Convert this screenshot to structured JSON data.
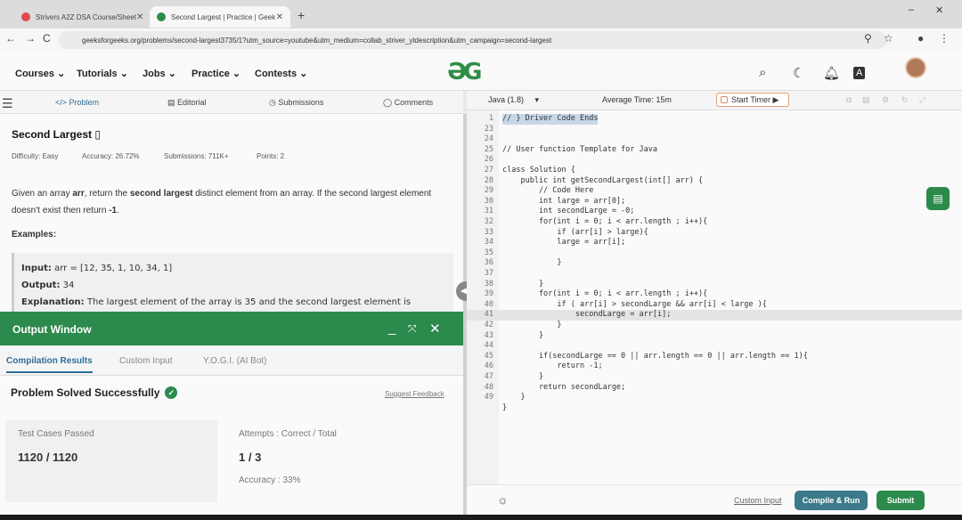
{
  "browser": {
    "tabs": [
      {
        "label": "Strivers A2Z DSA Course/Sheet",
        "active": false,
        "favicon_color": "#e24b4b"
      },
      {
        "label": "Second Largest | Practice | Geek",
        "active": true,
        "favicon_color": "#2f8d46"
      }
    ],
    "new_tab": "+",
    "url": "geeksforgeeks.org/problems/second-largest3735/1?utm_source=youtube&utm_medium=collab_striver_ytdescription&utm_campaign=second-largest",
    "nav": {
      "back": "←",
      "forward": "→",
      "reload": "C"
    },
    "win": {
      "min": "–",
      "max": "◻",
      "close": "✕"
    }
  },
  "site": {
    "menu": [
      "Courses ⌄",
      "Tutorials ⌄",
      "Jobs ⌄",
      "Practice ⌄",
      "Contests ⌄"
    ],
    "logo": "ƏG",
    "brand_color": "#2f8d46"
  },
  "problem_tabs": [
    "Problem",
    "Editorial",
    "Submissions",
    "Comments"
  ],
  "problem": {
    "title": "Second Largest",
    "difficulty": "Difficulty: Easy",
    "accuracy": "Accuracy: 26.72%",
    "submissions": "Submissions: 711K+",
    "points": "Points: 2",
    "description_1": "Given an array ",
    "description_arr": "arr",
    "description_2": ", return the ",
    "description_bold": "second largest",
    "description_3": " distinct element from an array. If the second largest element doesn't exist then return ",
    "description_neg": "-1",
    "description_4": ".",
    "examples_heading": "Examples:",
    "input_label": "Input:",
    "input_value": " arr = [12, 35, 1, 10, 34, 1]",
    "output_label": "Output:",
    "output_value": " 34",
    "explanation_label": "Explanation:",
    "explanation_value": " The largest element of the array is 35 and the second largest element is"
  },
  "output_window": {
    "title": "Output Window",
    "tabs": [
      "Compilation Results",
      "Custom Input",
      "Y.O.G.I. (AI Bot)"
    ],
    "status": "Problem Solved Successfully",
    "feedback": "Suggest Feedback",
    "test_cases_label": "Test Cases Passed",
    "test_cases_value": "1120 / 1120",
    "attempts_label": "Attempts : Correct / Total",
    "attempts_value": "1 / 3",
    "accuracy_label": "Accuracy : 33%"
  },
  "editor_toolbar": {
    "language": "Java (1.8)",
    "avg_time": "Average Time: 15m",
    "start_timer": "Start Timer"
  },
  "code_lines": [
    {
      "n": "1",
      "text": "// } Driver Code Ends"
    },
    {
      "n": "23",
      "text": ""
    },
    {
      "n": "24",
      "text": ""
    },
    {
      "n": "25",
      "text": "// User function Template for Java"
    },
    {
      "n": "26",
      "text": ""
    },
    {
      "n": "27",
      "text": "class Solution {"
    },
    {
      "n": "28",
      "text": "    public int getSecondLargest(int[] arr) {"
    },
    {
      "n": "29",
      "text": "        // Code Here"
    },
    {
      "n": "30",
      "text": "        int large = arr[0];"
    },
    {
      "n": "31",
      "text": "        int secondLarge = -0;"
    },
    {
      "n": "32",
      "text": "        for(int i = 0; i < arr.length ; i++){"
    },
    {
      "n": "33",
      "text": "            if (arr[i] > large){"
    },
    {
      "n": "34",
      "text": "            large = arr[i];"
    },
    {
      "n": "35",
      "text": ""
    },
    {
      "n": "36",
      "text": "            }"
    },
    {
      "n": "37",
      "text": ""
    },
    {
      "n": "38",
      "text": "        }"
    },
    {
      "n": "39",
      "text": "        for(int i = 0; i < arr.length ; i++){"
    },
    {
      "n": "40",
      "text": "            if ( arr[i] > secondLarge && arr[i] < large ){"
    },
    {
      "n": "41",
      "text": "                secondLarge = arr[i];"
    },
    {
      "n": "42",
      "text": "            }"
    },
    {
      "n": "43",
      "text": "        }"
    },
    {
      "n": "44",
      "text": ""
    },
    {
      "n": "45",
      "text": "        if(secondLarge == 0 || arr.length == 0 || arr.length == 1){"
    },
    {
      "n": "46",
      "text": "            return -1;"
    },
    {
      "n": "47",
      "text": "        }"
    },
    {
      "n": "48",
      "text": "        return secondLarge;"
    },
    {
      "n": "49",
      "text": "    }"
    },
    {
      "n": "",
      "text": "}"
    }
  ],
  "editor_bottom": {
    "custom_input": "Custom Input",
    "compile_run": "Compile & Run",
    "submit": "Submit"
  }
}
